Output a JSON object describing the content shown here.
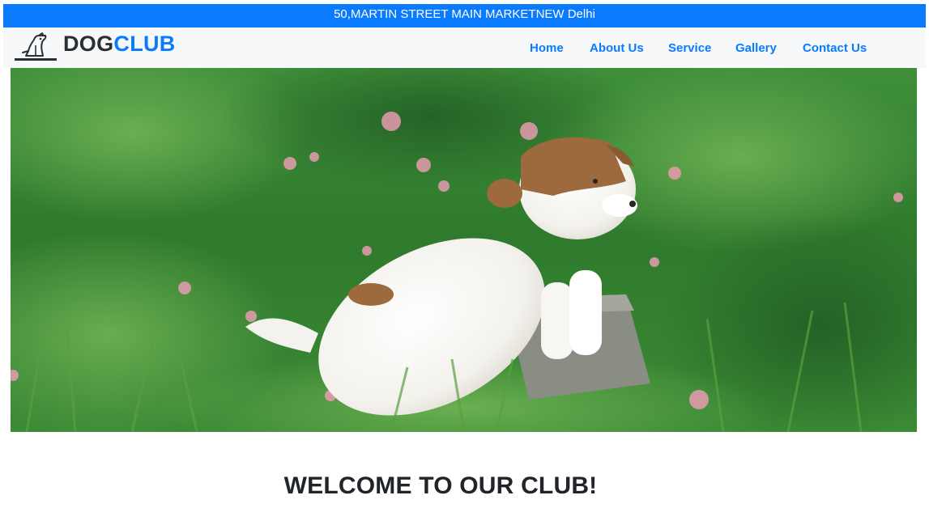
{
  "topbar": {
    "address": "50,MARTIN STREET MAIN MARKETNEW Delhi"
  },
  "brand": {
    "part1": "DOG",
    "part2": "CLUB",
    "logo_icon": "dog-sitting-icon"
  },
  "nav": {
    "items": [
      {
        "label": "Home"
      },
      {
        "label": "About Us"
      },
      {
        "label": "Service"
      },
      {
        "label": "Gallery"
      },
      {
        "label": "Contact Us"
      }
    ]
  },
  "hero": {
    "image": "puppy-in-grass-photo"
  },
  "main": {
    "welcome": "WELCOME TO OUR CLUB!"
  },
  "colors": {
    "primary": "#0a7bff",
    "dark_text": "#212529",
    "navbar_bg": "#f7f8f9"
  }
}
